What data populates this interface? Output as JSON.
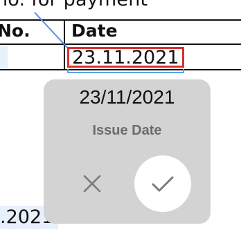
{
  "document": {
    "header_text": "no. for payment",
    "columns": {
      "no_label": "No.",
      "date_label": "Date"
    },
    "date_field_value": "23.11.2021",
    "bottom_fragment": ".2021"
  },
  "popup": {
    "date_display": "23/11/2021",
    "field_label": "Issue Date",
    "cancel_icon": "close-icon",
    "confirm_icon": "check-icon"
  },
  "colors": {
    "field_outline": "#d9302c",
    "field_underline": "#5aa2e6",
    "connector_line": "#5b8be0",
    "popup_background": "#d3d3d3",
    "label_color": "#6b6b6b",
    "cell_highlight": "#e8f0fb"
  }
}
